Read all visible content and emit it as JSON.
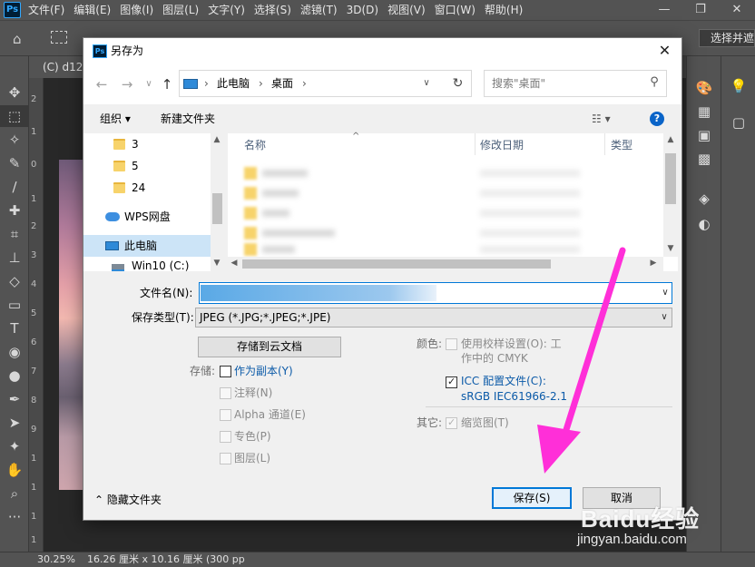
{
  "app": {
    "logo": "Ps",
    "menus": [
      "文件(F)",
      "编辑(E)",
      "图像(I)",
      "图层(L)",
      "文字(Y)",
      "选择(S)",
      "滤镜(T)",
      "3D(D)",
      "视图(V)",
      "窗口(W)",
      "帮助(H)"
    ],
    "window_controls": [
      "—",
      "❐",
      "✕"
    ],
    "options_right": "选择并遮",
    "doc_tab": "(C) d127"
  },
  "ruler": [
    "2",
    "1",
    "0",
    "1",
    "2",
    "3",
    "4",
    "5",
    "6",
    "7",
    "8",
    "9",
    "1",
    "1",
    "1",
    "1"
  ],
  "status": {
    "zoom": "30.25%",
    "doc_size": "16.26 厘米 x 10.16 厘米 (300 pp"
  },
  "dialog": {
    "icon": "Ps",
    "title": "另存为",
    "close": "✕",
    "breadcrumbs": [
      "此电脑",
      "桌面"
    ],
    "search_placeholder": "搜索\"桌面\"",
    "toolbar": {
      "organize": "组织 ▾",
      "new_folder": "新建文件夹",
      "view": "☷ ▾",
      "help": "?"
    },
    "tree": [
      {
        "label": "3",
        "type": "folder"
      },
      {
        "label": "5",
        "type": "folder"
      },
      {
        "label": "24",
        "type": "folder"
      },
      {
        "label": "WPS网盘",
        "type": "cloud"
      },
      {
        "label": "此电脑",
        "type": "pc",
        "selected": true
      },
      {
        "label": "Win10 (C:)",
        "type": "drive"
      }
    ],
    "columns": {
      "name": "名称",
      "modified": "修改日期",
      "type": "类型"
    },
    "filename_label": "文件名(N):",
    "filetype_label": "保存类型(T):",
    "filetype_value": "JPEG (*.JPG;*.JPEG;*.JPE)",
    "save_cloud": "存储到云文档",
    "storage_label": "存储:",
    "save_as_copy": "作为副本(Y)",
    "notes": "注释(N)",
    "alpha": "Alpha 通道(E)",
    "spot": "专色(P)",
    "layers": "图层(L)",
    "color_label": "颜色:",
    "use_proof_line1": "使用校样设置(O): 工",
    "use_proof_line2": "作中的 CMYK",
    "icc_line1": "ICC 配置文件(C):",
    "icc_line2": "sRGB IEC61966-2.1",
    "other_label": "其它:",
    "thumbnail": "缩览图(T)",
    "hide_folders": "隐藏文件夹",
    "save_button": "保存(S)",
    "cancel_button": "取消"
  },
  "watermark": {
    "brand": "Baidu经验",
    "site": "jingyan.baidu.com"
  },
  "colors": {
    "annotation_arrow": "#ff2fd8",
    "accent": "#0078d7"
  }
}
